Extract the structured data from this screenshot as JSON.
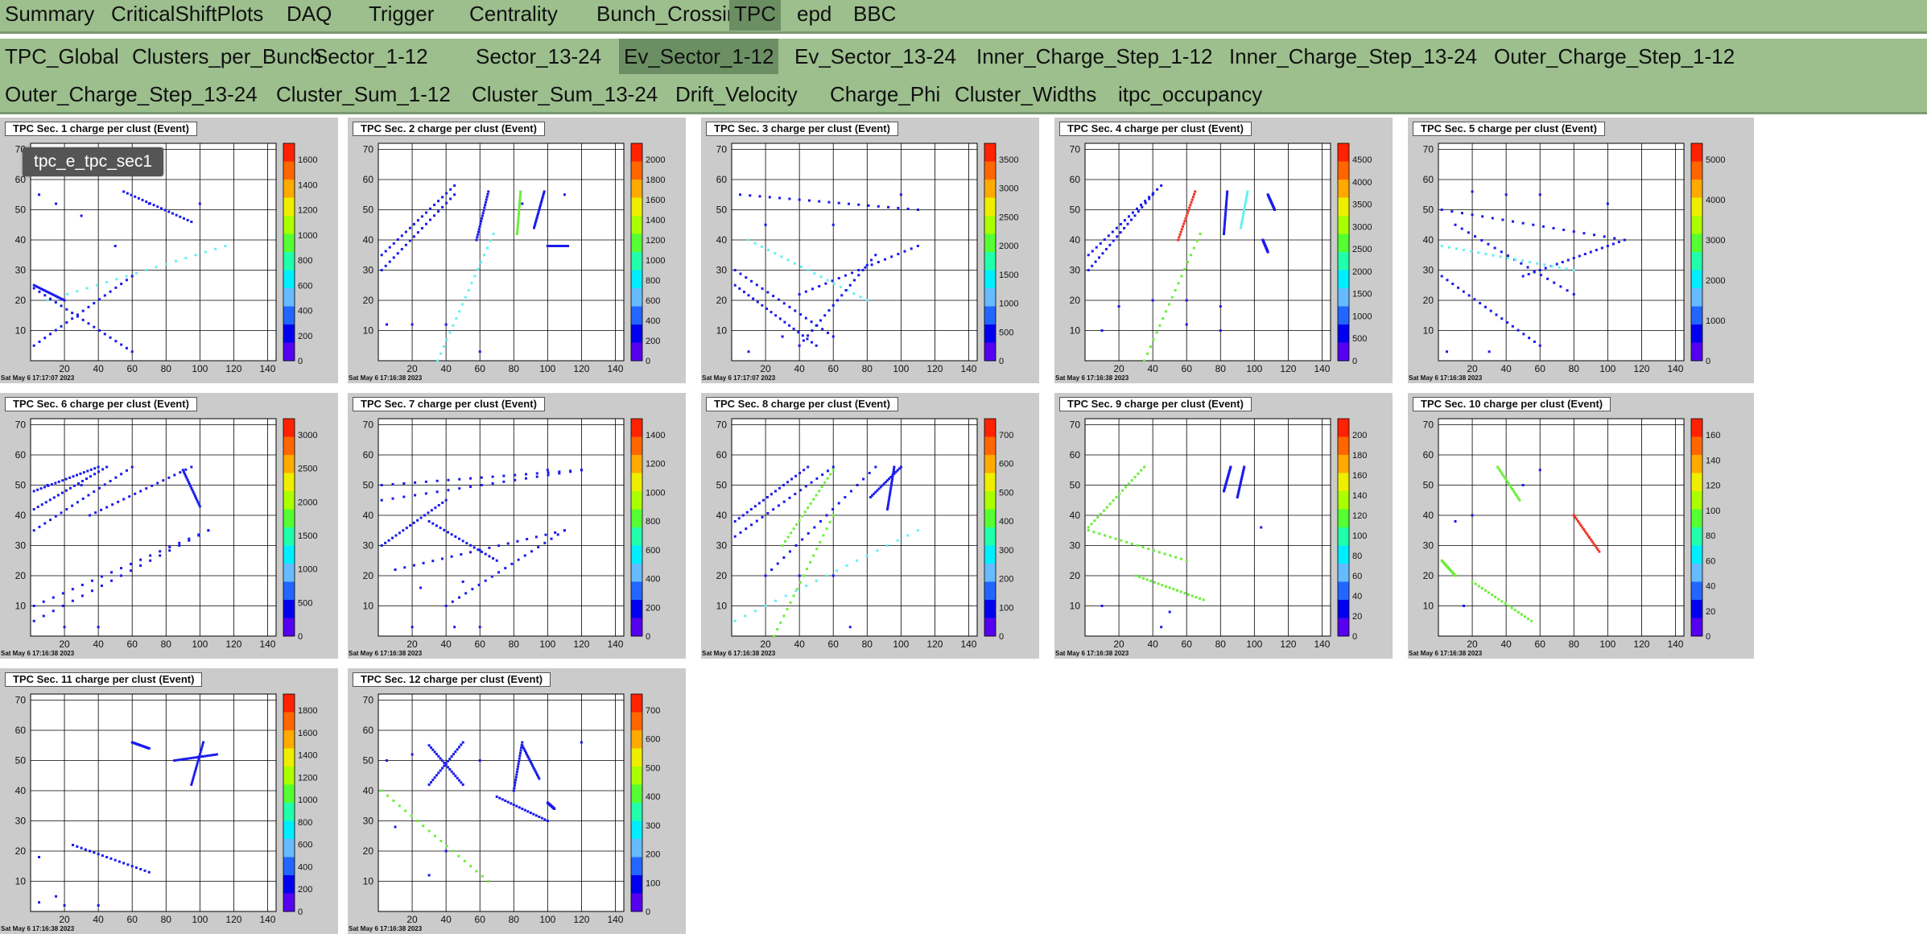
{
  "menu_tabs": [
    "Summary",
    "CriticalShiftPlots",
    "DAQ",
    "Trigger",
    "Centrality",
    "Bunch_Crossings",
    "TPC",
    "epd",
    "BBC"
  ],
  "menu_active": "TPC",
  "sub_tabs_row1": [
    "TPC_Global",
    "Clusters_per_Bunch",
    "Sector_1-12",
    "Sector_13-24",
    "Ev_Sector_1-12",
    "Ev_Sector_13-24",
    "Inner_Charge_Step_1-12",
    "Inner_Charge_Step_13-24",
    "Outer_Charge_Step_1-12"
  ],
  "sub_tabs_row2": [
    "Outer_Charge_Step_13-24",
    "Cluster_Sum_1-12",
    "Cluster_Sum_13-24",
    "Drift_Velocity",
    "Charge_Phi",
    "Cluster_Widths",
    "itpc_occupancy"
  ],
  "sub_active": "Ev_Sector_1-12",
  "tooltip": "tpc_e_tpc_sec1",
  "colors": {
    "menu_bg": "#9cbf8d",
    "active_tab": "#6b8f63",
    "panel_bg": "#cbcbcb",
    "marker": "#1a1aee"
  },
  "chart_data": [
    {
      "type": "heatmap",
      "title": "TPC Sec. 1 charge per clust (Event)",
      "date": "Sat May 6 17:17:07 2023",
      "xticks": [
        "20",
        "40",
        "60",
        "80",
        "100",
        "120",
        "140"
      ],
      "yticks": [
        "10",
        "20",
        "30",
        "40",
        "50",
        "60",
        "70"
      ],
      "zticks": [
        "0",
        "200",
        "400",
        "600",
        "800",
        "1000",
        "1200",
        "1400",
        "1600"
      ],
      "xlim": [
        0,
        145
      ],
      "ylim": [
        0,
        72
      ],
      "segments": [
        [
          2,
          5,
          60,
          28,
          "#1a1aee"
        ],
        [
          10,
          20,
          115,
          38,
          "#66f0f0"
        ],
        [
          2,
          24,
          60,
          3,
          "#1a1aee"
        ],
        [
          55,
          56,
          95,
          46,
          "#1a1aee"
        ],
        [
          2,
          25,
          20,
          20,
          "#1a1aee"
        ]
      ],
      "scatter": [
        [
          5,
          55
        ],
        [
          15,
          52
        ],
        [
          30,
          48
        ],
        [
          50,
          38
        ],
        [
          70,
          52
        ],
        [
          100,
          52
        ]
      ]
    },
    {
      "type": "heatmap",
      "title": "TPC Sec. 2 charge per clust (Event)",
      "date": "Sat May 6 17:16:38 2023",
      "xticks": [
        "20",
        "40",
        "60",
        "80",
        "100",
        "120",
        "140"
      ],
      "yticks": [
        "10",
        "20",
        "30",
        "40",
        "50",
        "60",
        "70"
      ],
      "zticks": [
        "0",
        "200",
        "400",
        "600",
        "800",
        "1000",
        "1200",
        "1400",
        "1600",
        "1800",
        "2000"
      ],
      "xlim": [
        0,
        145
      ],
      "ylim": [
        0,
        72
      ],
      "segments": [
        [
          2,
          30,
          45,
          55,
          "#1a1aee"
        ],
        [
          2,
          35,
          45,
          58,
          "#1a1aee"
        ],
        [
          35,
          0,
          68,
          42,
          "#66f0f0"
        ],
        [
          58,
          40,
          65,
          56,
          "#1a1aee"
        ],
        [
          82,
          42,
          84,
          56,
          "#6bee3a"
        ],
        [
          92,
          44,
          98,
          56,
          "#1a1aee"
        ],
        [
          100,
          38,
          112,
          38,
          "#1a1aee"
        ]
      ],
      "scatter": [
        [
          5,
          12
        ],
        [
          20,
          12
        ],
        [
          40,
          12
        ],
        [
          60,
          3
        ],
        [
          85,
          52
        ],
        [
          110,
          55
        ]
      ]
    },
    {
      "type": "heatmap",
      "title": "TPC Sec. 3 charge per clust (Event)",
      "date": "Sat May 6 17:17:07 2023",
      "xticks": [
        "20",
        "40",
        "60",
        "80",
        "100",
        "120",
        "140"
      ],
      "yticks": [
        "10",
        "20",
        "30",
        "40",
        "50",
        "60",
        "70"
      ],
      "zticks": [
        "0",
        "500",
        "1000",
        "1500",
        "2000",
        "2500",
        "3000",
        "3500"
      ],
      "xlim": [
        0,
        145
      ],
      "ylim": [
        0,
        72
      ],
      "segments": [
        [
          2,
          30,
          60,
          8,
          "#1a1aee"
        ],
        [
          2,
          25,
          50,
          5,
          "#1a1aee"
        ],
        [
          10,
          40,
          80,
          20,
          "#66f0f0"
        ],
        [
          40,
          22,
          110,
          38,
          "#1a1aee"
        ],
        [
          40,
          5,
          85,
          35,
          "#1a1aee"
        ],
        [
          5,
          55,
          110,
          50,
          "#1a1aee"
        ]
      ],
      "scatter": [
        [
          20,
          45
        ],
        [
          60,
          45
        ],
        [
          100,
          55
        ],
        [
          10,
          3
        ],
        [
          30,
          8
        ]
      ]
    },
    {
      "type": "heatmap",
      "title": "TPC Sec. 4 charge per clust (Event)",
      "date": "Sat May 6 17:16:38 2023",
      "xticks": [
        "20",
        "40",
        "60",
        "80",
        "100",
        "120",
        "140"
      ],
      "yticks": [
        "10",
        "20",
        "30",
        "40",
        "50",
        "60",
        "70"
      ],
      "zticks": [
        "0",
        "500",
        "1000",
        "1500",
        "2000",
        "2500",
        "3000",
        "3500",
        "4000",
        "4500"
      ],
      "xlim": [
        0,
        145
      ],
      "ylim": [
        0,
        72
      ],
      "segments": [
        [
          2,
          30,
          40,
          55,
          "#1a1aee"
        ],
        [
          2,
          35,
          45,
          58,
          "#1a1aee"
        ],
        [
          35,
          0,
          68,
          42,
          "#6bee3a"
        ],
        [
          55,
          40,
          65,
          56,
          "#ee3322"
        ],
        [
          82,
          42,
          84,
          56,
          "#1a1aee"
        ],
        [
          92,
          44,
          96,
          56,
          "#66f0f0"
        ],
        [
          105,
          40,
          108,
          36,
          "#1a1aee"
        ],
        [
          108,
          55,
          112,
          50,
          "#1a1aee"
        ]
      ],
      "scatter": [
        [
          20,
          18
        ],
        [
          40,
          20
        ],
        [
          60,
          20
        ],
        [
          80,
          18
        ],
        [
          10,
          10
        ],
        [
          60,
          12
        ],
        [
          80,
          10
        ]
      ]
    },
    {
      "type": "heatmap",
      "title": "TPC Sec. 5 charge per clust (Event)",
      "date": "Sat May 6 17:16:38 2023",
      "xticks": [
        "20",
        "40",
        "60",
        "80",
        "100",
        "120",
        "140"
      ],
      "yticks": [
        "10",
        "20",
        "30",
        "40",
        "50",
        "60",
        "70"
      ],
      "zticks": [
        "0",
        "1000",
        "2000",
        "3000",
        "4000",
        "5000"
      ],
      "xlim": [
        0,
        145
      ],
      "ylim": [
        0,
        72
      ],
      "segments": [
        [
          2,
          28,
          60,
          5,
          "#1a1aee"
        ],
        [
          2,
          50,
          110,
          40,
          "#1a1aee"
        ],
        [
          10,
          45,
          80,
          22,
          "#1a1aee"
        ],
        [
          50,
          28,
          110,
          40,
          "#1a1aee"
        ],
        [
          2,
          38,
          80,
          30,
          "#66f0f0"
        ]
      ],
      "scatter": [
        [
          20,
          56
        ],
        [
          40,
          55
        ],
        [
          60,
          55
        ],
        [
          100,
          52
        ],
        [
          5,
          3
        ],
        [
          30,
          3
        ]
      ]
    },
    {
      "type": "heatmap",
      "title": "TPC Sec. 6 charge per clust (Event)",
      "date": "Sat May 6 17:16:38 2023",
      "xticks": [
        "20",
        "40",
        "60",
        "80",
        "100",
        "120",
        "140"
      ],
      "yticks": [
        "10",
        "20",
        "30",
        "40",
        "50",
        "60",
        "70"
      ],
      "zticks": [
        "0",
        "500",
        "1000",
        "1500",
        "2000",
        "2500",
        "3000"
      ],
      "xlim": [
        0,
        145
      ],
      "ylim": [
        0,
        72
      ],
      "segments": [
        [
          2,
          35,
          60,
          56,
          "#1a1aee"
        ],
        [
          2,
          42,
          45,
          56,
          "#1a1aee"
        ],
        [
          35,
          40,
          95,
          56,
          "#1a1aee"
        ],
        [
          90,
          55,
          100,
          43,
          "#1a1aee"
        ],
        [
          2,
          5,
          105,
          35,
          "#1a1aee"
        ],
        [
          2,
          10,
          105,
          35,
          "#1a1aee"
        ],
        [
          2,
          48,
          40,
          56,
          "#1a1aee"
        ]
      ],
      "scatter": [
        [
          20,
          3
        ],
        [
          40,
          3
        ],
        [
          10,
          50
        ],
        [
          30,
          50
        ]
      ]
    },
    {
      "type": "heatmap",
      "title": "TPC Sec. 7 charge per clust (Event)",
      "date": "Sat May 6 17:16:38 2023",
      "xticks": [
        "20",
        "40",
        "60",
        "80",
        "100",
        "120",
        "140"
      ],
      "yticks": [
        "10",
        "20",
        "30",
        "40",
        "50",
        "60",
        "70"
      ],
      "zticks": [
        "0",
        "200",
        "400",
        "600",
        "800",
        "1000",
        "1200",
        "1400"
      ],
      "xlim": [
        0,
        145
      ],
      "ylim": [
        0,
        72
      ],
      "segments": [
        [
          2,
          30,
          40,
          45,
          "#1a1aee"
        ],
        [
          2,
          45,
          120,
          55,
          "#1a1aee"
        ],
        [
          2,
          50,
          120,
          55,
          "#1a1aee"
        ],
        [
          40,
          10,
          110,
          35,
          "#1a1aee"
        ],
        [
          30,
          38,
          70,
          25,
          "#1a1aee"
        ],
        [
          10,
          22,
          110,
          35,
          "#1a1aee"
        ]
      ],
      "scatter": [
        [
          20,
          3
        ],
        [
          45,
          3
        ],
        [
          60,
          3
        ],
        [
          25,
          16
        ],
        [
          50,
          18
        ],
        [
          100,
          55
        ]
      ]
    },
    {
      "type": "heatmap",
      "title": "TPC Sec. 8 charge per clust (Event)",
      "date": "Sat May 6 17:16:38 2023",
      "xticks": [
        "20",
        "40",
        "60",
        "80",
        "100",
        "120",
        "140"
      ],
      "yticks": [
        "10",
        "20",
        "30",
        "40",
        "50",
        "60",
        "70"
      ],
      "zticks": [
        "0",
        "100",
        "200",
        "300",
        "400",
        "500",
        "600",
        "700"
      ],
      "xlim": [
        0,
        145
      ],
      "ylim": [
        0,
        72
      ],
      "segments": [
        [
          2,
          33,
          60,
          56,
          "#1a1aee"
        ],
        [
          2,
          38,
          45,
          56,
          "#1a1aee"
        ],
        [
          25,
          0,
          60,
          40,
          "#6bee3a"
        ],
        [
          2,
          5,
          110,
          35,
          "#66f0f0"
        ],
        [
          20,
          20,
          85,
          56,
          "#1a1aee"
        ],
        [
          82,
          46,
          100,
          56,
          "#1a1aee"
        ],
        [
          92,
          42,
          96,
          56,
          "#1a1aee"
        ],
        [
          30,
          30,
          60,
          55,
          "#6bee3a"
        ]
      ],
      "scatter": [
        [
          70,
          3
        ],
        [
          40,
          20
        ],
        [
          60,
          20
        ]
      ]
    },
    {
      "type": "heatmap",
      "title": "TPC Sec. 9 charge per clust (Event)",
      "date": "Sat May 6 17:16:38 2023",
      "xticks": [
        "20",
        "40",
        "60",
        "80",
        "100",
        "120",
        "140"
      ],
      "yticks": [
        "10",
        "20",
        "30",
        "40",
        "50",
        "60",
        "70"
      ],
      "zticks": [
        "0",
        "20",
        "40",
        "60",
        "80",
        "100",
        "120",
        "140",
        "160",
        "180",
        "200"
      ],
      "xlim": [
        0,
        145
      ],
      "ylim": [
        0,
        72
      ],
      "segments": [
        [
          2,
          36,
          35,
          56,
          "#6bee3a"
        ],
        [
          2,
          35,
          60,
          25,
          "#6bee3a"
        ],
        [
          30,
          20,
          70,
          12,
          "#6bee3a"
        ],
        [
          82,
          48,
          86,
          56,
          "#1a1aee"
        ],
        [
          90,
          46,
          94,
          56,
          "#1a1aee"
        ]
      ],
      "scatter": [
        [
          10,
          10
        ],
        [
          50,
          8
        ],
        [
          104,
          36
        ],
        [
          45,
          3
        ]
      ]
    },
    {
      "type": "heatmap",
      "title": "TPC Sec. 10 charge per clust (Event)",
      "date": "Sat May 6 17:16:38 2023",
      "xticks": [
        "20",
        "40",
        "60",
        "80",
        "100",
        "120",
        "140"
      ],
      "yticks": [
        "10",
        "20",
        "30",
        "40",
        "50",
        "60",
        "70"
      ],
      "zticks": [
        "0",
        "20",
        "40",
        "60",
        "80",
        "100",
        "120",
        "140",
        "160"
      ],
      "xlim": [
        0,
        145
      ],
      "ylim": [
        0,
        72
      ],
      "segments": [
        [
          35,
          56,
          48,
          45,
          "#6bee3a"
        ],
        [
          80,
          40,
          95,
          28,
          "#ee3322"
        ],
        [
          20,
          18,
          55,
          5,
          "#6bee3a"
        ],
        [
          2,
          25,
          10,
          20,
          "#6bee3a"
        ]
      ],
      "scatter": [
        [
          60,
          55
        ],
        [
          50,
          50
        ],
        [
          15,
          10
        ],
        [
          10,
          38
        ],
        [
          20,
          40
        ]
      ]
    },
    {
      "type": "heatmap",
      "title": "TPC Sec. 11 charge per clust (Event)",
      "date": "Sat May 6 17:16:38 2023",
      "xticks": [
        "20",
        "40",
        "60",
        "80",
        "100",
        "120",
        "140"
      ],
      "yticks": [
        "10",
        "20",
        "30",
        "40",
        "50",
        "60",
        "70"
      ],
      "zticks": [
        "0",
        "200",
        "400",
        "600",
        "800",
        "1000",
        "1200",
        "1400",
        "1600",
        "1800"
      ],
      "xlim": [
        0,
        145
      ],
      "ylim": [
        0,
        72
      ],
      "segments": [
        [
          85,
          50,
          110,
          52,
          "#1a1aee"
        ],
        [
          95,
          42,
          102,
          56,
          "#1a1aee"
        ],
        [
          25,
          22,
          70,
          13,
          "#1a1aee"
        ],
        [
          60,
          56,
          70,
          54,
          "#1a1aee"
        ]
      ],
      "scatter": [
        [
          5,
          18
        ],
        [
          5,
          3
        ],
        [
          20,
          2
        ],
        [
          40,
          2
        ],
        [
          15,
          5
        ]
      ]
    },
    {
      "type": "heatmap",
      "title": "TPC Sec. 12 charge per clust (Event)",
      "date": "Sat May 6 17:16:38 2023",
      "xticks": [
        "20",
        "40",
        "60",
        "80",
        "100",
        "120",
        "140"
      ],
      "yticks": [
        "10",
        "20",
        "30",
        "40",
        "50",
        "60",
        "70"
      ],
      "zticks": [
        "0",
        "100",
        "200",
        "300",
        "400",
        "500",
        "600",
        "700"
      ],
      "xlim": [
        0,
        145
      ],
      "ylim": [
        0,
        72
      ],
      "segments": [
        [
          2,
          40,
          65,
          10,
          "#6bee3a"
        ],
        [
          30,
          55,
          50,
          42,
          "#1a1aee"
        ],
        [
          30,
          42,
          50,
          56,
          "#1a1aee"
        ],
        [
          80,
          40,
          85,
          56,
          "#1a1aee"
        ],
        [
          85,
          55,
          95,
          44,
          "#1a1aee"
        ],
        [
          70,
          38,
          100,
          30,
          "#1a1aee"
        ],
        [
          100,
          36,
          104,
          34,
          "#1a1aee"
        ]
      ],
      "scatter": [
        [
          5,
          50
        ],
        [
          20,
          52
        ],
        [
          60,
          50
        ],
        [
          120,
          56
        ],
        [
          10,
          28
        ],
        [
          40,
          20
        ],
        [
          30,
          12
        ]
      ]
    }
  ]
}
